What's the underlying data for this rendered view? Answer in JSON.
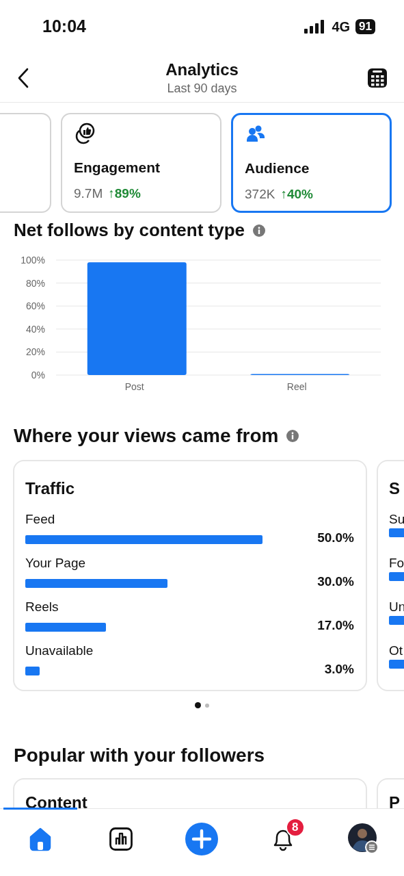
{
  "status_bar": {
    "time": "10:04",
    "network": "4G",
    "battery": "91"
  },
  "header": {
    "title": "Analytics",
    "subtitle": "Last 90 days"
  },
  "tiles": [
    {
      "kind": "blank",
      "selected": false
    },
    {
      "kind": "engagement",
      "title": "Engagement",
      "value": "9.7M",
      "change": "↑89%",
      "selected": false
    },
    {
      "kind": "audience",
      "title": "Audience",
      "value": "372K",
      "change": "↑40%",
      "selected": true
    }
  ],
  "net_follows": {
    "title": "Net follows by content type",
    "chart_data": {
      "type": "bar",
      "grid": true,
      "categories": [
        "Post",
        "Reel"
      ],
      "values": [
        98,
        0.5
      ],
      "ylim": [
        0,
        100
      ],
      "yticks": [
        {
          "value": 0,
          "label": "0%"
        },
        {
          "value": 20,
          "label": "20%"
        },
        {
          "value": 40,
          "label": "40%"
        },
        {
          "value": 60,
          "label": "60%"
        },
        {
          "value": 80,
          "label": "80%"
        },
        {
          "value": 100,
          "label": "100%"
        }
      ]
    }
  },
  "views": {
    "title": "Where your views came from",
    "cards": [
      {
        "title": "Traffic",
        "rows": [
          {
            "label": "Feed",
            "level": 1,
            "value": "50.0%"
          },
          {
            "label": "Your Page",
            "level": 0.6,
            "value": "30.0%"
          },
          {
            "label": "Reels",
            "level": 0.34,
            "value": "17.0%"
          },
          {
            "label": "Unavailable",
            "level": 0.06,
            "value": "3.0%"
          }
        ]
      },
      {
        "title": "S",
        "rows": [
          {
            "label": "Su"
          },
          {
            "label": "Fo"
          },
          {
            "label": "Un"
          },
          {
            "label": "Ot"
          }
        ]
      }
    ],
    "dots": [
      {
        "selected": true
      },
      {
        "selected": false
      }
    ]
  },
  "popular": {
    "title": "Popular with your followers",
    "cards": [
      {
        "title": "Content"
      },
      {
        "title": "P"
      }
    ]
  },
  "nav": [
    {
      "kind": "home",
      "selected": true
    },
    {
      "kind": "stats",
      "selected": false
    },
    {
      "kind": "create",
      "selected": false
    },
    {
      "kind": "notifications",
      "selected": false,
      "badge": "8"
    },
    {
      "kind": "profile",
      "selected": false
    }
  ]
}
